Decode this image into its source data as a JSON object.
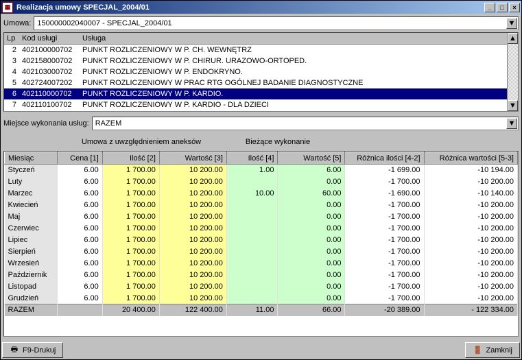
{
  "window": {
    "title": "Realizacja umowy SPECJAL_2004/01"
  },
  "umowa": {
    "label": "Umowa:",
    "value": "150000002040007 - SPECJAL_2004/01"
  },
  "list": {
    "headers": {
      "lp": "Lp",
      "kod": "Kod usługi",
      "usluga": "Usługa"
    },
    "rows": [
      {
        "lp": "2",
        "kod": "402100000702",
        "usluga": "PUNKT ROZLICZENIOWY W P. CH. WEWNĘTRZ",
        "sel": false
      },
      {
        "lp": "3",
        "kod": "402158000702",
        "usluga": "PUNKT ROZLICZENIOWY W P. CHIRUR. URAZOWO-ORTOPED.",
        "sel": false
      },
      {
        "lp": "4",
        "kod": "402103000702",
        "usluga": "PUNKT ROZLICZENIOWY W P. ENDOKRYNO.",
        "sel": false
      },
      {
        "lp": "5",
        "kod": "402724007202",
        "usluga": "PUNKT ROZLICZENIOWY W PRAC RTG OGÓLNEJ BADANIE DIAGNOSTYCZNE",
        "sel": false
      },
      {
        "lp": "6",
        "kod": "402110000702",
        "usluga": "PUNKT ROZLICZENIOWY W P. KARDIO.",
        "sel": true
      },
      {
        "lp": "7",
        "kod": "402110100702",
        "usluga": "PUNKT ROZLICZENIOWY W P. KARDIO - DLA DZIECI",
        "sel": false
      }
    ]
  },
  "miejsce": {
    "label": "Miejsce wykonania usług:",
    "value": "RAZEM"
  },
  "group_headers": {
    "g1": "Umowa z uwzględnieniem aneksów",
    "g2": "Bieżące wykonanie"
  },
  "grid": {
    "headers": {
      "miesiac": "Miesiąc",
      "cena": "Cena [1]",
      "ilosc": "Ilość [2]",
      "wartosc": "Wartość [3]",
      "ilosc2": "Ilość [4]",
      "wartosc2": "Wartość [5]",
      "rozn_ilosc": "Różnica ilości [4-2]",
      "rozn_wart": "Różnica wartości [5-3]"
    },
    "total_label": "RAZEM"
  },
  "chart_data": {
    "type": "table",
    "columns": [
      "Miesiąc",
      "Cena [1]",
      "Ilość [2]",
      "Wartość [3]",
      "Ilość [4]",
      "Wartość [5]",
      "Różnica ilości [4-2]",
      "Różnica wartości [5-3]"
    ],
    "rows": [
      {
        "miesiac": "Styczeń",
        "cena": "6.00",
        "ilosc": "1 700.00",
        "wart": "10 200.00",
        "ilosc2": "1.00",
        "wart2": "6.00",
        "r1": "-1 699.00",
        "r2": "-10 194.00"
      },
      {
        "miesiac": "Luty",
        "cena": "6.00",
        "ilosc": "1 700.00",
        "wart": "10 200.00",
        "ilosc2": "",
        "wart2": "0.00",
        "r1": "-1 700.00",
        "r2": "-10 200.00"
      },
      {
        "miesiac": "Marzec",
        "cena": "6.00",
        "ilosc": "1 700.00",
        "wart": "10 200.00",
        "ilosc2": "10.00",
        "wart2": "60.00",
        "r1": "-1 690.00",
        "r2": "-10 140.00"
      },
      {
        "miesiac": "Kwiecień",
        "cena": "6.00",
        "ilosc": "1 700.00",
        "wart": "10 200.00",
        "ilosc2": "",
        "wart2": "0.00",
        "r1": "-1 700.00",
        "r2": "-10 200.00"
      },
      {
        "miesiac": "Maj",
        "cena": "6.00",
        "ilosc": "1 700.00",
        "wart": "10 200.00",
        "ilosc2": "",
        "wart2": "0.00",
        "r1": "-1 700.00",
        "r2": "-10 200.00"
      },
      {
        "miesiac": "Czerwiec",
        "cena": "6.00",
        "ilosc": "1 700.00",
        "wart": "10 200.00",
        "ilosc2": "",
        "wart2": "0.00",
        "r1": "-1 700.00",
        "r2": "-10 200.00"
      },
      {
        "miesiac": "Lipiec",
        "cena": "6.00",
        "ilosc": "1 700.00",
        "wart": "10 200.00",
        "ilosc2": "",
        "wart2": "0.00",
        "r1": "-1 700.00",
        "r2": "-10 200.00"
      },
      {
        "miesiac": "Sierpień",
        "cena": "6.00",
        "ilosc": "1 700.00",
        "wart": "10 200.00",
        "ilosc2": "",
        "wart2": "0.00",
        "r1": "-1 700.00",
        "r2": "-10 200.00"
      },
      {
        "miesiac": "Wrzesień",
        "cena": "6.00",
        "ilosc": "1 700.00",
        "wart": "10 200.00",
        "ilosc2": "",
        "wart2": "0.00",
        "r1": "-1 700.00",
        "r2": "-10 200.00"
      },
      {
        "miesiac": "Październik",
        "cena": "6.00",
        "ilosc": "1 700.00",
        "wart": "10 200.00",
        "ilosc2": "",
        "wart2": "0.00",
        "r1": "-1 700.00",
        "r2": "-10 200.00"
      },
      {
        "miesiac": "Listopad",
        "cena": "6.00",
        "ilosc": "1 700.00",
        "wart": "10 200.00",
        "ilosc2": "",
        "wart2": "0.00",
        "r1": "-1 700.00",
        "r2": "-10 200.00"
      },
      {
        "miesiac": "Grudzień",
        "cena": "6.00",
        "ilosc": "1 700.00",
        "wart": "10 200.00",
        "ilosc2": "",
        "wart2": "0.00",
        "r1": "-1 700.00",
        "r2": "-10 200.00"
      }
    ],
    "total": {
      "miesiac": "RAZEM",
      "cena": "",
      "ilosc": "20 400.00",
      "wart": "122 400.00",
      "ilosc2": "11.00",
      "wart2": "66.00",
      "r1": "-20 389.00",
      "r2": "- 122 334.00"
    }
  },
  "buttons": {
    "print": "F9-Drukuj",
    "close": "Zamknij"
  }
}
